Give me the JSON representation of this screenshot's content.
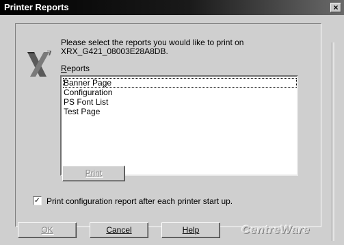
{
  "window": {
    "title": "Printer Reports",
    "close_glyph": "×"
  },
  "prompt": {
    "line1": "Please select the reports you would like to print on",
    "line2": "XRX_G421_08003E28A8DB."
  },
  "reports": {
    "label": "Reports",
    "items": [
      "Banner Page",
      "Configuration",
      "PS Font List",
      "Test Page"
    ],
    "focused_item": "Banner Page"
  },
  "print_button": {
    "label": "Print",
    "enabled": false
  },
  "startup_option": {
    "label": "Print configuration report after each printer start up.",
    "checked": true,
    "check_glyph": "✓"
  },
  "footer": {
    "ok_label": "OK",
    "cancel_label": "Cancel",
    "help_label": "Help",
    "brand": "CentreWare"
  },
  "icons": {
    "logo": "xerox-x-logo-icon",
    "close": "close-icon",
    "check": "check-icon"
  }
}
